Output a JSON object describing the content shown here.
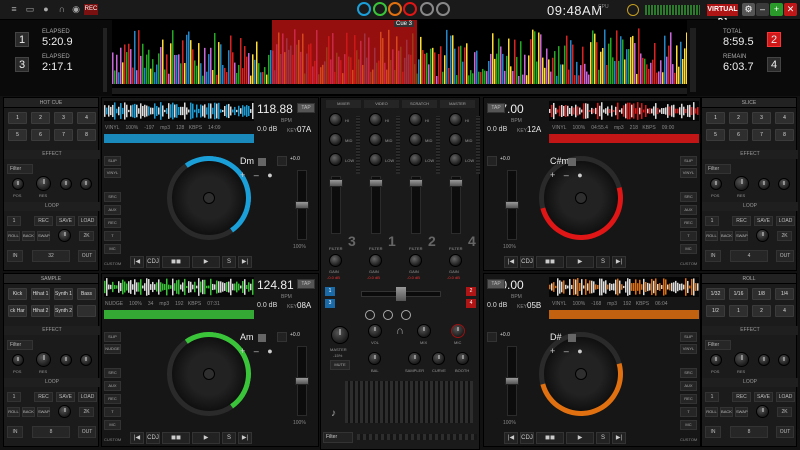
{
  "topbar": {
    "rec_label": "REC",
    "clock": "09:48AM",
    "cpu": "CPU",
    "brand": "VIRTUAL DJ"
  },
  "overview": {
    "left": {
      "deck_a": "1",
      "deck_b": "3",
      "elapsed_label_a": "ELAPSED",
      "elapsed_a": "5:20.9",
      "elapsed_label_b": "ELAPSED",
      "elapsed_b": "2:17.1"
    },
    "right": {
      "deck_a": "2",
      "deck_b": "4",
      "total_label": "TOTAL",
      "total": "8:59.5",
      "remain_label": "REMAIN",
      "remain": "6:03.7"
    },
    "cue_label": "Cue 3"
  },
  "left_top_panel": {
    "title": "HOT CUE",
    "pads": [
      "1",
      "2",
      "3",
      "4",
      "5",
      "6",
      "7",
      "8"
    ],
    "effect_title": "EFFECT",
    "filter": "Filter",
    "pos": "POS",
    "res": "RES",
    "loop_title": "LOOP",
    "loop_buttons": [
      "REC",
      "SAVE",
      "LOAD"
    ],
    "loop_row2": [
      "ROLL",
      "BACK",
      "SWAP"
    ],
    "loop_len": "32",
    "in": "IN",
    "out": "OUT",
    "beat": "1",
    "beat2": "2K"
  },
  "left_bot_panel": {
    "title": "SAMPLE",
    "pads": [
      "Kick",
      "Hihat 1",
      "Synth 1",
      "Bass",
      "ck Har",
      "Hihat 2",
      "Synth 2",
      ""
    ],
    "effect_title": "EFFECT",
    "filter": "Filter",
    "pos": "POS",
    "res": "RES",
    "loop_title": "LOOP",
    "loop_buttons": [
      "REC",
      "SAVE",
      "LOAD"
    ],
    "loop_row2": [
      "ROLL",
      "BACK",
      "SWAP"
    ],
    "loop_len": "8",
    "in": "IN",
    "out": "OUT",
    "beat": "1",
    "beat2": "2K"
  },
  "right_top_panel": {
    "title": "SLICE",
    "pads": [
      "1",
      "2",
      "3",
      "4",
      "5",
      "6",
      "7",
      "8"
    ],
    "effect_title": "EFFECT",
    "filter": "Filter",
    "pos": "POS",
    "res": "RES",
    "loop_title": "LOOP",
    "loop_buttons": [
      "REC",
      "SAVE",
      "LOAD"
    ],
    "loop_row2": [
      "ROLL",
      "BACK",
      "SWAP"
    ],
    "loop_len": "4",
    "in": "IN",
    "out": "OUT",
    "beat": "1",
    "beat2": "2K"
  },
  "right_bot_panel": {
    "title": "ROLL",
    "pads": [
      "1/32",
      "1/16",
      "1/8",
      "1/4",
      "1/2",
      "1",
      "2",
      "4"
    ],
    "effect_title": "EFFECT",
    "filter": "Filter",
    "pos": "POS",
    "res": "RES",
    "loop_title": "LOOP",
    "loop_buttons": [
      "REC",
      "SAVE",
      "LOAD"
    ],
    "loop_row2": [
      "ROLL",
      "BACK",
      "SWAP"
    ],
    "loop_len": "8",
    "in": "IN",
    "out": "OUT",
    "beat": "1",
    "beat2": "2K"
  },
  "deck1": {
    "bpm": "118.88",
    "bpm_label": "BPM",
    "db": "0.0 dB",
    "key_label": "KEY",
    "key": "07A",
    "info": [
      "VINYL",
      "100%",
      "-197",
      "mp3",
      "128 KBPS",
      "14:09"
    ],
    "tap": "TAP",
    "key_display": "Dm",
    "pitch": "+0.0",
    "pct": "100%",
    "custom": "CUSTOM",
    "side": [
      "SLIP",
      "VINYL",
      "SRC",
      "AUX",
      "REC",
      "T",
      "MC"
    ],
    "transport": [
      "|◀",
      "CDJ",
      "◼◼",
      "▶",
      "S",
      "▶|"
    ],
    "color": "#1a9fd8"
  },
  "deck2": {
    "bpm": "137.00",
    "bpm_label": "BPM",
    "db": "0.0 dB",
    "key_label": "KEY",
    "key": "12A",
    "info": [
      "VINYL",
      "100%",
      "04:55.4",
      "mp3",
      "218 KBPS",
      "09:00"
    ],
    "tap": "TAP",
    "key_display": "C#m",
    "pitch": "+0.0",
    "pct": "100%",
    "custom": "CUSTOM",
    "side": [
      "SLIP",
      "VINYL",
      "SRC",
      "AUX",
      "REC",
      "T",
      "MC"
    ],
    "transport": [
      "|◀",
      "CDJ",
      "◼◼",
      "▶",
      "S",
      "▶|"
    ],
    "color": "#e01515"
  },
  "deck3": {
    "bpm": "124.81",
    "bpm_label": "BPM",
    "db": "0.0 dB",
    "key_label": "KEY",
    "key": "08A",
    "info": [
      "NUDGE",
      "100%",
      "34",
      "mp3",
      "192 KBPS",
      "07:31"
    ],
    "tap": "TAP",
    "key_display": "Am",
    "pitch": "+0.0",
    "pct": "100%",
    "custom": "CUSTOM",
    "side": [
      "SLIP",
      "NUDGE",
      "SRC",
      "AUX",
      "REC",
      "T",
      "MC"
    ],
    "transport": [
      "|◀",
      "CDJ",
      "◼◼",
      "▶",
      "S",
      "▶|"
    ],
    "color": "#3ac43a"
  },
  "deck4": {
    "bpm": "170.00",
    "bpm_label": "BPM",
    "db": "0.0 dB",
    "key_label": "KEY",
    "key": "05B",
    "info": [
      "VINYL",
      "100%",
      "-168",
      "mp3",
      "192 KBPS",
      "06:04"
    ],
    "tap": "TAP",
    "key_display": "D#",
    "pitch": "+0.0",
    "pct": "100%",
    "custom": "CUSTOM",
    "side": [
      "SLIP",
      "VINYL",
      "SRC",
      "AUX",
      "REC",
      "T",
      "MC"
    ],
    "transport": [
      "|◀",
      "CDJ",
      "◼◼",
      "▶",
      "S",
      "▶|"
    ],
    "color": "#e07010"
  },
  "mixer": {
    "tabs": [
      "MIXER",
      "VIDEO",
      "SCRATCH",
      "MASTER"
    ],
    "eq": [
      "HI",
      "MID",
      "LOW"
    ],
    "filter": "FILTER",
    "gain": "GAIN",
    "gain_db": "-0.0 dB",
    "deck_nums": [
      "3",
      "1",
      "2",
      "4"
    ],
    "master": "MASTER",
    "vol": "VOL",
    "mix": "MIX",
    "mic": "MIC",
    "bal": "BAL",
    "sampler": "SAMPLER",
    "curve": "CURVE",
    "booth": "BOOTH",
    "mute": "MUTE",
    "filter_btn": "Filter",
    "master_pct": "-15%"
  },
  "colors": {
    "deck1": "#1a9fd8",
    "deck2": "#e01515",
    "deck3": "#3ac43a",
    "deck4": "#e07010"
  }
}
